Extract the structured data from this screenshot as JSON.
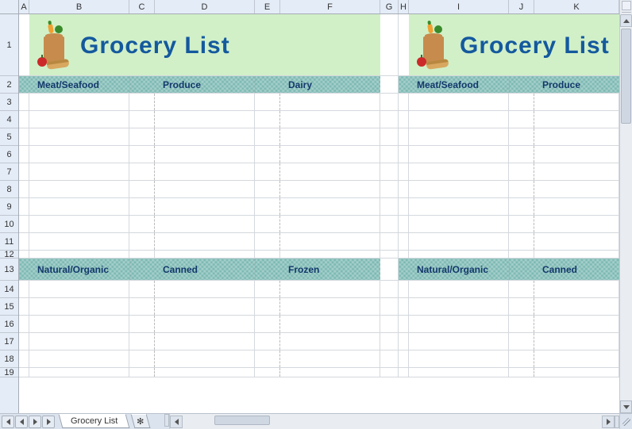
{
  "columns": [
    "A",
    "B",
    "C",
    "D",
    "E",
    "F",
    "G",
    "H",
    "I",
    "J",
    "K"
  ],
  "rows": [
    "1",
    "2",
    "3",
    "4",
    "5",
    "6",
    "7",
    "8",
    "9",
    "10",
    "11",
    "12",
    "13",
    "14",
    "15",
    "16",
    "17",
    "18",
    "19"
  ],
  "title": "Grocery List",
  "section1": {
    "meat": "Meat/Seafood",
    "produce": "Produce",
    "dairy": "Dairy"
  },
  "section2": {
    "natural": "Natural/Organic",
    "canned": "Canned",
    "frozen": "Frozen"
  },
  "sheet_tab": "Grocery List"
}
